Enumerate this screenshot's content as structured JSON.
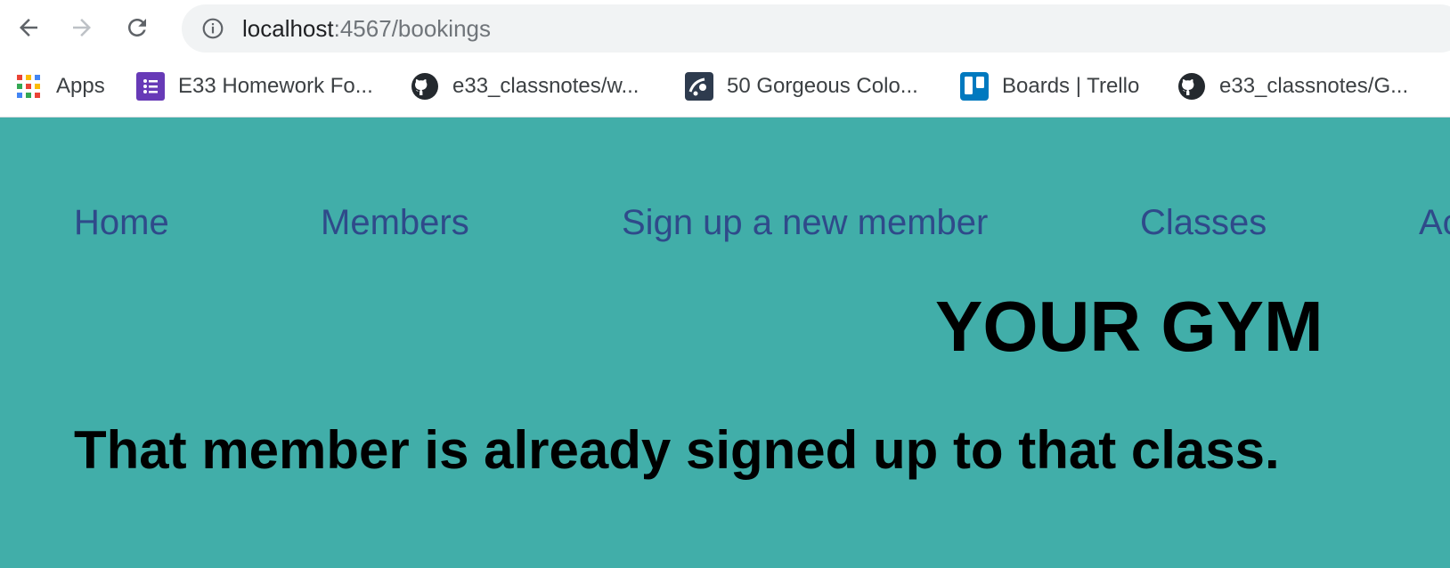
{
  "browser": {
    "url_host": "localhost",
    "url_rest": ":4567/bookings",
    "nav_icons": [
      "back-arrow-icon",
      "forward-arrow-icon",
      "reload-icon"
    ],
    "info_icon": "info-circle-icon"
  },
  "bookmarks": [
    {
      "label": "Apps",
      "icon": "apps-grid-icon"
    },
    {
      "label": "E33 Homework Fo...",
      "icon": "google-forms-icon"
    },
    {
      "label": "e33_classnotes/w...",
      "icon": "github-icon"
    },
    {
      "label": "50 Gorgeous Colo...",
      "icon": "site-favicon-icon"
    },
    {
      "label": "Boards | Trello",
      "icon": "trello-icon"
    },
    {
      "label": "e33_classnotes/G...",
      "icon": "github-icon"
    }
  ],
  "site": {
    "nav": [
      {
        "label": "Home"
      },
      {
        "label": "Members"
      },
      {
        "label": "Sign up a new member"
      },
      {
        "label": "Classes"
      },
      {
        "label": "Ac"
      }
    ],
    "title": "YOUR GYM",
    "message": "That member is already signed up to that class."
  },
  "colors": {
    "page_background": "#41aea9",
    "nav_link": "#2f4a8a",
    "heading_text": "#000000"
  }
}
